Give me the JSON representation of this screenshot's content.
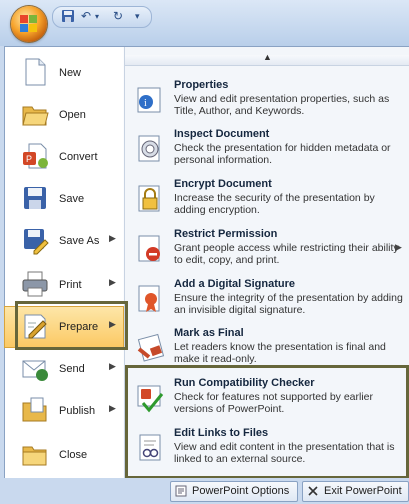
{
  "left_menu": {
    "items": [
      {
        "label": "New",
        "icon": "new-document-icon"
      },
      {
        "label": "Open",
        "icon": "open-folder-icon"
      },
      {
        "label": "Convert",
        "icon": "convert-icon"
      },
      {
        "label": "Save",
        "icon": "save-icon"
      },
      {
        "label": "Save As",
        "icon": "save-as-icon"
      },
      {
        "label": "Print",
        "icon": "printer-icon"
      },
      {
        "label": "Prepare",
        "icon": "prepare-icon"
      },
      {
        "label": "Send",
        "icon": "send-icon"
      },
      {
        "label": "Publish",
        "icon": "publish-icon"
      },
      {
        "label": "Close",
        "icon": "close-folder-icon"
      }
    ],
    "selected": "Prepare"
  },
  "prepare_menu": {
    "items": [
      {
        "title": "Properties",
        "desc": "View and edit presentation properties, such as Title, Author, and Keywords."
      },
      {
        "title": "Inspect Document",
        "desc": "Check the presentation for hidden metadata or personal information."
      },
      {
        "title": "Encrypt Document",
        "desc": "Increase the security of the presentation by adding encryption."
      },
      {
        "title": "Restrict Permission",
        "desc": "Grant people access while restricting their ability to edit, copy, and print."
      },
      {
        "title": "Add a Digital Signature",
        "desc": "Ensure the integrity of the presentation by adding an invisible digital signature."
      },
      {
        "title": "Mark as Final",
        "desc": "Let readers know the presentation is final and make it read-only."
      },
      {
        "title": "Run Compatibility Checker",
        "desc": "Check for features not supported by earlier versions of PowerPoint."
      },
      {
        "title": "Edit Links to Files",
        "desc": "View and edit content in the presentation that is linked to an external source."
      }
    ]
  },
  "footer": {
    "options_label": "PowerPoint Options",
    "exit_label": "Exit PowerPoint"
  },
  "qat": {
    "separator": "▾"
  }
}
